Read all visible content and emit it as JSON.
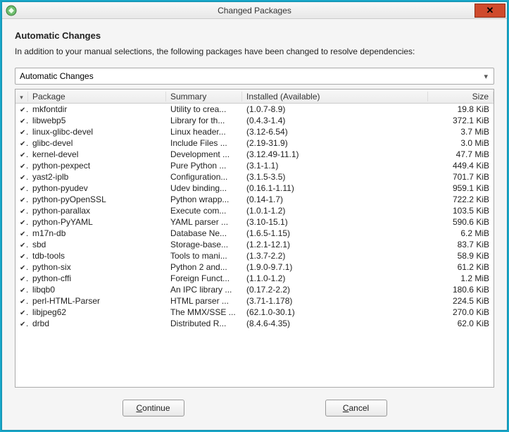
{
  "window": {
    "title": "Changed Packages"
  },
  "header": {
    "title": "Automatic Changes",
    "description": "In addition to your manual selections, the following packages have been changed to resolve dependencies:"
  },
  "dropdown": {
    "selected": "Automatic Changes"
  },
  "columns": {
    "package": "Package",
    "summary": "Summary",
    "installed": "Installed (Available)",
    "size": "Size"
  },
  "rows": [
    {
      "pkg": "mkfontdir",
      "sum": "Utility to crea...",
      "inst": "(1.0.7-8.9)",
      "size": "19.8 KiB"
    },
    {
      "pkg": "libwebp5",
      "sum": "Library for th...",
      "inst": "(0.4.3-1.4)",
      "size": "372.1 KiB"
    },
    {
      "pkg": "linux-glibc-devel",
      "sum": "Linux header...",
      "inst": "(3.12-6.54)",
      "size": "3.7 MiB"
    },
    {
      "pkg": "glibc-devel",
      "sum": "Include Files ...",
      "inst": "(2.19-31.9)",
      "size": "3.0 MiB"
    },
    {
      "pkg": "kernel-devel",
      "sum": "Development ...",
      "inst": "(3.12.49-11.1)",
      "size": "47.7 MiB"
    },
    {
      "pkg": "python-pexpect",
      "sum": "Pure Python ...",
      "inst": "(3.1-1.1)",
      "size": "449.4 KiB"
    },
    {
      "pkg": "yast2-iplb",
      "sum": "Configuration...",
      "inst": "(3.1.5-3.5)",
      "size": "701.7 KiB"
    },
    {
      "pkg": "python-pyudev",
      "sum": "Udev binding...",
      "inst": "(0.16.1-1.11)",
      "size": "959.1 KiB"
    },
    {
      "pkg": "python-pyOpenSSL",
      "sum": "Python wrapp...",
      "inst": "(0.14-1.7)",
      "size": "722.2 KiB"
    },
    {
      "pkg": "python-parallax",
      "sum": "Execute com...",
      "inst": "(1.0.1-1.2)",
      "size": "103.5 KiB"
    },
    {
      "pkg": "python-PyYAML",
      "sum": "YAML parser ...",
      "inst": "(3.10-15.1)",
      "size": "590.6 KiB"
    },
    {
      "pkg": "m17n-db",
      "sum": "Database Ne...",
      "inst": "(1.6.5-1.15)",
      "size": "6.2 MiB"
    },
    {
      "pkg": "sbd",
      "sum": "Storage-base...",
      "inst": "(1.2.1-12.1)",
      "size": "83.7 KiB"
    },
    {
      "pkg": "tdb-tools",
      "sum": "Tools to mani...",
      "inst": "(1.3.7-2.2)",
      "size": "58.9 KiB"
    },
    {
      "pkg": "python-six",
      "sum": "Python 2 and...",
      "inst": "(1.9.0-9.7.1)",
      "size": "61.2 KiB"
    },
    {
      "pkg": "python-cffi",
      "sum": "Foreign Funct...",
      "inst": "(1.1.0-1.2)",
      "size": "1.2 MiB"
    },
    {
      "pkg": "libqb0",
      "sum": "An IPC library ...",
      "inst": "(0.17.2-2.2)",
      "size": "180.6 KiB"
    },
    {
      "pkg": "perl-HTML-Parser",
      "sum": "HTML parser ...",
      "inst": "(3.71-1.178)",
      "size": "224.5 KiB"
    },
    {
      "pkg": "libjpeg62",
      "sum": "The MMX/SSE ...",
      "inst": "(62.1.0-30.1)",
      "size": "270.0 KiB"
    },
    {
      "pkg": "drbd",
      "sum": "Distributed R...",
      "inst": "(8.4.6-4.35)",
      "size": "62.0 KiB"
    }
  ],
  "buttons": {
    "continue_accel": "C",
    "continue_rest": "ontinue",
    "cancel_accel": "C",
    "cancel_rest": "ancel"
  }
}
